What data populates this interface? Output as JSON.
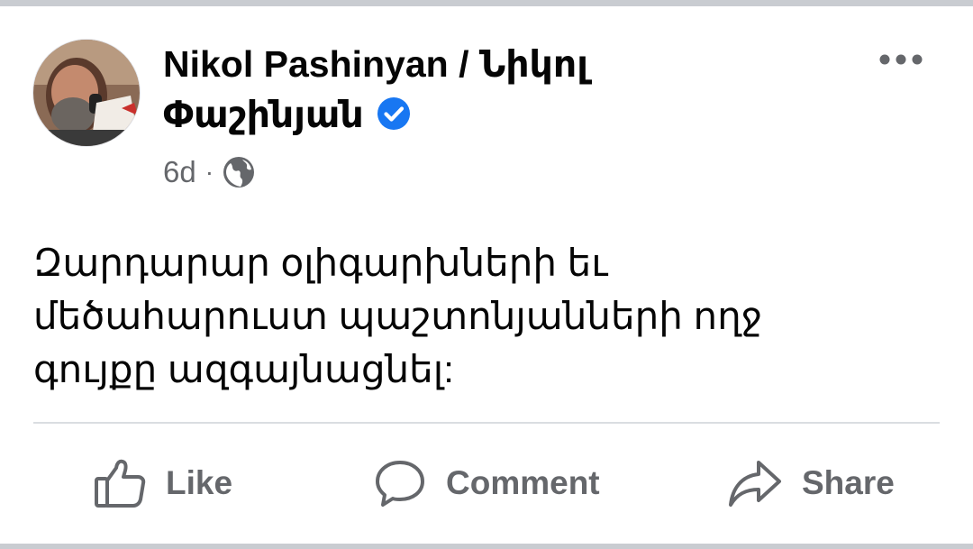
{
  "post": {
    "author": "Nikol Pashinyan / Նիկոլ Փաշինյան",
    "time": "6d",
    "separator": "·",
    "audience_icon": "globe-icon",
    "verified_icon": "verified-badge-icon",
    "text": "Զարդարար օլիգարխների եւ\nմեծահարուստ պաշտոնյանների ողջ\nգույքը ազգայնացնել:"
  },
  "actions": {
    "like_label": "Like",
    "comment_label": "Comment",
    "share_label": "Share"
  },
  "colors": {
    "primary_text": "#050505",
    "secondary_text": "#65676b",
    "verified_blue": "#1877f2",
    "divider": "#dadde1"
  }
}
